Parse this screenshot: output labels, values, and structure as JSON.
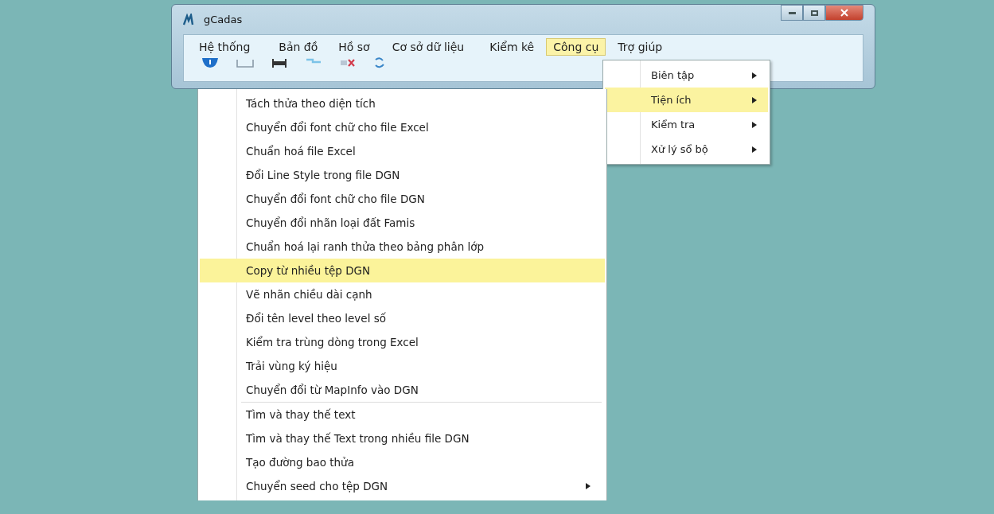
{
  "window": {
    "title": "gCadas"
  },
  "menu_bar": [
    {
      "label": "Hệ thống",
      "selected": false
    },
    {
      "label": "Bản đồ",
      "selected": false
    },
    {
      "label": "Hồ sơ",
      "selected": false
    },
    {
      "label": "Cơ sở dữ liệu",
      "selected": false
    },
    {
      "label": "Kiểm kê",
      "selected": false
    },
    {
      "label": "Công cụ",
      "selected": true
    },
    {
      "label": "Trợ giúp",
      "selected": false
    }
  ],
  "cong_cu_menu": [
    {
      "label": "Biên tập",
      "selected": false,
      "submenu": true
    },
    {
      "label": "Tiện ích",
      "selected": true,
      "submenu": true
    },
    {
      "label": "Kiểm tra",
      "selected": false,
      "submenu": true
    },
    {
      "label": "Xử lý sổ bộ",
      "selected": false,
      "submenu": true
    }
  ],
  "tien_ich_menu": [
    [
      {
        "label": "Tách thửa theo diện tích",
        "selected": false,
        "submenu": false
      },
      {
        "label": "Chuyển đổi font chữ cho file Excel",
        "selected": false,
        "submenu": false
      },
      {
        "label": "Chuẩn hoá file Excel",
        "selected": false,
        "submenu": false
      },
      {
        "label": "Đổi Line Style trong file DGN",
        "selected": false,
        "submenu": false
      },
      {
        "label": "Chuyển đổi font chữ cho file DGN",
        "selected": false,
        "submenu": false
      },
      {
        "label": "Chuyển đổi nhãn loại đất Famis",
        "selected": false,
        "submenu": false
      },
      {
        "label": "Chuẩn hoá lại ranh thửa theo bảng phân lớp",
        "selected": false,
        "submenu": false
      },
      {
        "label": "Copy từ nhiều tệp DGN",
        "selected": true,
        "submenu": false
      },
      {
        "label": "Vẽ nhãn chiều dài cạnh",
        "selected": false,
        "submenu": false
      },
      {
        "label": "Đổi tên level theo level số",
        "selected": false,
        "submenu": false
      },
      {
        "label": "Kiểm tra trùng dòng trong Excel",
        "selected": false,
        "submenu": false
      },
      {
        "label": "Trải vùng ký hiệu",
        "selected": false,
        "submenu": false
      },
      {
        "label": "Chuyển đổi từ MapInfo vào DGN",
        "selected": false,
        "submenu": false
      }
    ],
    [
      {
        "label": "Tìm và thay thế text",
        "selected": false,
        "submenu": false
      },
      {
        "label": "Tìm và thay thế Text trong nhiều file DGN",
        "selected": false,
        "submenu": false
      },
      {
        "label": "Tạo đường bao thửa",
        "selected": false,
        "submenu": false
      },
      {
        "label": "Chuyển seed cho tệp DGN",
        "selected": false,
        "submenu": true
      }
    ]
  ]
}
